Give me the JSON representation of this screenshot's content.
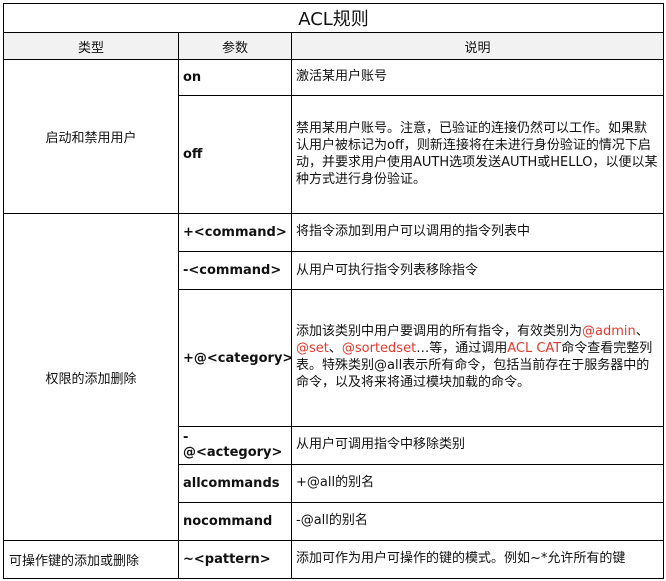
{
  "title": "ACL规则",
  "headers": [
    "类型",
    "参数",
    "说明"
  ],
  "groups": [
    {
      "category": "启动和禁用用户",
      "rows": [
        {
          "param": "on",
          "desc": "激活某用户账号"
        },
        {
          "param": "off",
          "desc": "禁用某用户账号。注意，已验证的连接仍然可以工作。如果默认用户被标记为off，则新连接将在未进行身份验证的情况下启动，并要求用户使用AUTH选项发送AUTH或HELLO，以便以某种方式进行身份验证。"
        }
      ]
    },
    {
      "category": "权限的添加删除",
      "rows": [
        {
          "param": "+<command>",
          "desc": "将指令添加到用户可以调用的指令列表中"
        },
        {
          "param": "-<command>",
          "desc": "从用户可执行指令列表移除指令"
        },
        {
          "param": "+@<category>",
          "desc_parts": [
            "添加该类别中用户要调用的所有指令，有效类别为",
            "@admin",
            "、",
            "@set",
            "、",
            "@sortedset",
            "…等，通过调用",
            "ACL CAT",
            "命令查看完整列表。特殊类别@all表示所有命令，包括当前存在于服务器中的命令，以及将来将通过模块加载的命令。"
          ]
        },
        {
          "param": "-@<actegory>",
          "desc": "从用户可调用指令中移除类别"
        },
        {
          "param": "allcommands",
          "desc": "+@all的别名"
        },
        {
          "param": "nocommand",
          "desc": "-@all的别名"
        }
      ]
    },
    {
      "category": "可操作键的添加或删除",
      "rows": [
        {
          "param": "~<pattern>",
          "desc": "添加可作为用户可操作的键的模式。例如~*允许所有的键"
        }
      ]
    }
  ],
  "colors": {
    "highlight": "#e03a2e",
    "header_bg": "#f2f2f2",
    "border": "#000000"
  }
}
